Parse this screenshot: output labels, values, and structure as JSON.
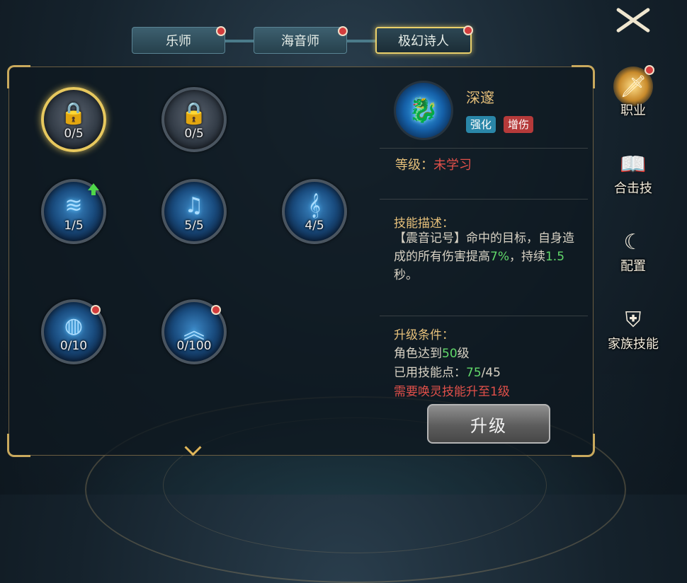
{
  "tabs": [
    {
      "label": "乐师",
      "active": false,
      "badge": true
    },
    {
      "label": "海音师",
      "active": false,
      "badge": true
    },
    {
      "label": "极幻诗人",
      "active": true,
      "badge": true
    }
  ],
  "skills": [
    {
      "level": "0/5",
      "locked": true,
      "selected": true,
      "badge": false,
      "upgrade": false,
      "icon": "lock-icon"
    },
    {
      "level": "0/5",
      "locked": true,
      "selected": false,
      "badge": false,
      "upgrade": false,
      "icon": "lock-icon"
    },
    {
      "level": "1/5",
      "locked": false,
      "selected": false,
      "badge": false,
      "upgrade": true,
      "icon": "sound-wave-icon"
    },
    {
      "level": "5/5",
      "locked": false,
      "selected": false,
      "badge": false,
      "upgrade": false,
      "icon": "music-notes-icon"
    },
    {
      "level": "4/5",
      "locked": false,
      "selected": false,
      "badge": false,
      "upgrade": false,
      "icon": "treble-clef-icon"
    },
    {
      "level": "0/10",
      "locked": false,
      "selected": false,
      "badge": true,
      "upgrade": false,
      "icon": "shield-dome-icon"
    },
    {
      "level": "0/100",
      "locked": false,
      "selected": false,
      "badge": true,
      "upgrade": false,
      "icon": "double-chevron-up-icon"
    }
  ],
  "detail": {
    "name": "深邃",
    "tags": [
      "强化",
      "增伤"
    ],
    "grade_label": "等级：",
    "grade_value": "未学习",
    "desc_title": "技能描述：",
    "desc_parts": {
      "p1": "【震音记号】命中的目标，自身造成的所有伤害提高",
      "v1": "7%",
      "p2": "，持续",
      "v2": "1.5",
      "p3": "秒。"
    },
    "cond_title": "升级条件：",
    "cond1_prefix": "角色达到",
    "cond1_value": "50",
    "cond1_suffix": "级",
    "cond2_prefix": "已用技能点：",
    "cond2_value": "75",
    "cond2_suffix": "/45",
    "cond3": "需要唤灵技能升至1级",
    "upgrade_label": "升级"
  },
  "side_nav": [
    {
      "label": "职业",
      "icon": "sword-icon",
      "active": true,
      "badge": true
    },
    {
      "label": "合击技",
      "icon": "book-icon",
      "active": false,
      "badge": false
    },
    {
      "label": "配置",
      "icon": "moon-star-icon",
      "active": false,
      "badge": false
    },
    {
      "label": "家族技能",
      "icon": "family-crest-icon",
      "active": false,
      "badge": false
    }
  ],
  "colors": {
    "accent_gold": "#e7c85e",
    "badge_red": "#d33d3d",
    "value_green": "#62d86a",
    "warn_red": "#e2504a"
  }
}
